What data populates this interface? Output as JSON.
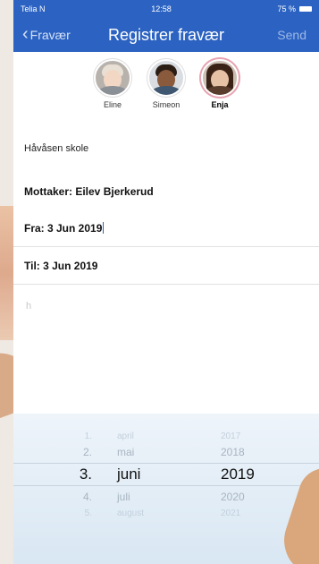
{
  "status_bar": {
    "carrier": "Telia N",
    "time": "12:58",
    "battery": "75 %"
  },
  "nav": {
    "back_label": "Fravær",
    "title": "Registrer fravær",
    "send_label": "Send"
  },
  "students": [
    {
      "name": "Eline",
      "selected": false
    },
    {
      "name": "Simeon",
      "selected": false
    },
    {
      "name": "Enja",
      "selected": true
    }
  ],
  "school": "Håvåsen skole",
  "recipient": "Mottaker: Eilev Bjerkerud",
  "from": "Fra: 3 Jun 2019",
  "to": "Til: 3 Jun 2019",
  "comment_text": "h",
  "picker": {
    "days": [
      "1.",
      "2.",
      "3.",
      "4.",
      "5."
    ],
    "months": [
      "april",
      "mai",
      "juni",
      "juli",
      "august"
    ],
    "years": [
      "2017",
      "2018",
      "2019",
      "2020",
      "2021"
    ],
    "selected_index": 2
  },
  "colors": {
    "nav_blue": "#2c63c2",
    "selected_ring": "#e8a3b2"
  }
}
